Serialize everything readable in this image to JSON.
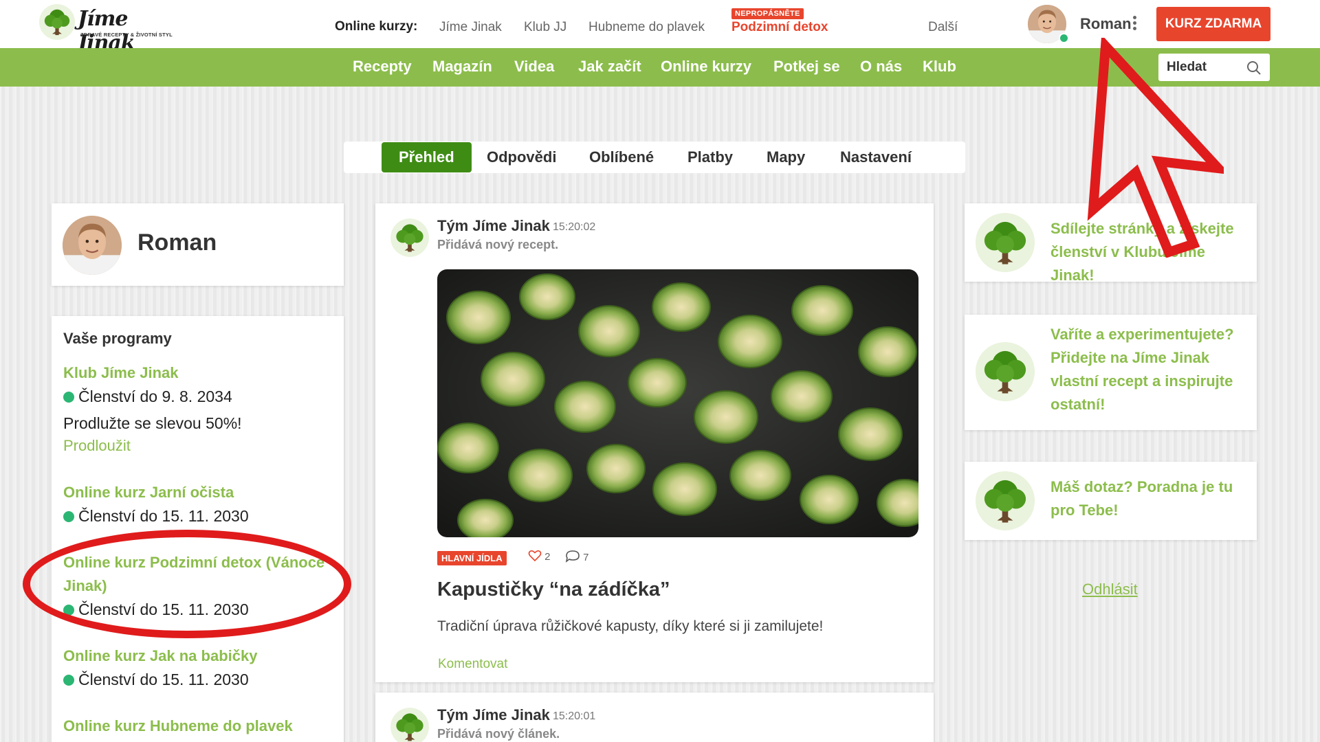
{
  "header": {
    "brand": "Jíme Jinak",
    "slogan": "ZDRAVÉ RECEPTY & ŽIVOTNÍ STYL",
    "online_label": "Online kurzy:",
    "online_links": [
      "Jíme Jinak",
      "Klub JJ",
      "Hubneme do plavek"
    ],
    "detox_badge": "NEPROPÁSNĚTE",
    "detox_link": "Podzimní detox",
    "more": "Další",
    "user_name": "Roman",
    "cta": "KURZ ZDARMA"
  },
  "nav": {
    "items": [
      "Recepty",
      "Magazín",
      "Videa",
      "Jak začít",
      "Online kurzy",
      "Potkej se",
      "O nás",
      "Klub"
    ],
    "search_placeholder": "Hledat"
  },
  "tabs": [
    "Přehled",
    "Odpovědi",
    "Oblíbené",
    "Platby",
    "Mapy",
    "Nastavení"
  ],
  "profile": {
    "name": "Roman"
  },
  "programs": {
    "title": "Vaše programy",
    "club": {
      "name": "Klub Jíme Jinak",
      "status": "Členství do 9. 8. 2034",
      "promo": "Prodlužte se slevou 50%!",
      "renew": "Prodloužit"
    },
    "items": [
      {
        "name": "Online kurz Jarní očista",
        "status": "Členství do 15. 11. 2030"
      },
      {
        "name": "Online kurz Podzimní detox (Vánoce Jinak)",
        "status": "Členství do 15. 11. 2030"
      },
      {
        "name": "Online kurz Jak na babičky",
        "status": "Členství do 15. 11. 2030"
      },
      {
        "name": "Online kurz Hubneme do plavek"
      }
    ]
  },
  "feed": [
    {
      "author": "Tým Jíme Jinak",
      "time": "15:20:02",
      "action": "Přidává nový recept.",
      "tag": "HLAVNÍ JÍDLA",
      "likes": "2",
      "comments": "7",
      "title": "Kapustičky “na zádíčka”",
      "description": "Tradiční úprava růžičkové kapusty, díky které si ji zamilujete!",
      "comment_link": "Komentovat"
    },
    {
      "author": "Tým Jíme Jinak",
      "time": "15:20:01",
      "action": "Přidává nový článek."
    }
  ],
  "sidebar_promos": [
    "Sdílejte stránky a získejte členství v Klubu Jíme Jinak!",
    "Vaříte a experimentujete? Přidejte na Jíme Jinak vlastní recept a inspirujte ostatní!",
    "Máš dotaz? Poradna je tu pro Tebe!"
  ],
  "logout": "Odhlásit",
  "colors": {
    "green": "#8cbd4c",
    "dark_green": "#3f8c15",
    "orange": "#e8452d",
    "annotation_red": "#e01b1b"
  }
}
